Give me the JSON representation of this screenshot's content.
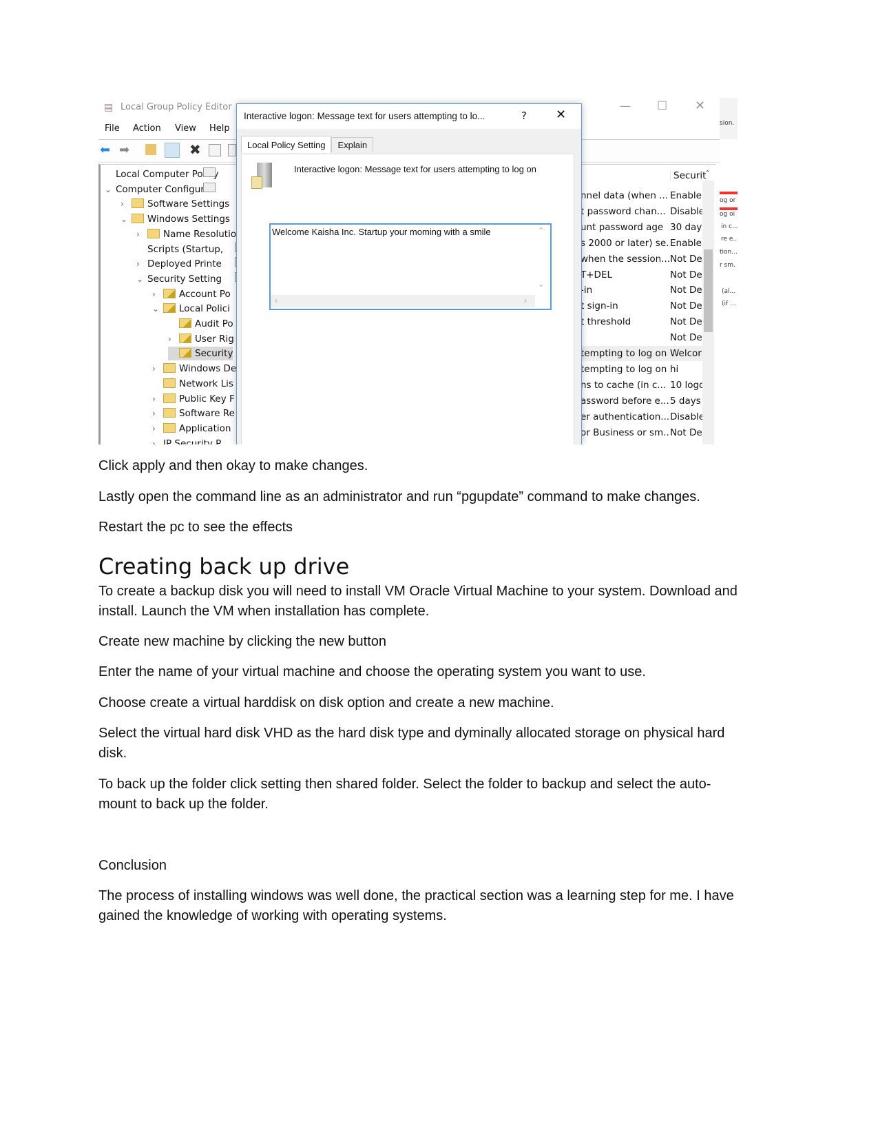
{
  "screenshot": {
    "main_window": {
      "title": "Local Group Policy Editor",
      "menu": [
        "File",
        "Action",
        "View",
        "Help"
      ],
      "window_controls": [
        "minimize-icon",
        "maximize-icon",
        "close-icon"
      ],
      "tree": [
        {
          "label": "Local Computer Policy",
          "level": 0,
          "chevron": "",
          "icon": "policy-icon"
        },
        {
          "label": "Computer Configurati",
          "level": 0,
          "chevron": "⌄",
          "icon": "computer-icon"
        },
        {
          "label": "Software Settings",
          "level": 1,
          "chevron": "›",
          "icon": "folder-icon"
        },
        {
          "label": "Windows Settings",
          "level": 1,
          "chevron": "⌄",
          "icon": "folder-icon"
        },
        {
          "label": "Name Resolutio",
          "level": 2,
          "chevron": "›",
          "icon": "folder-icon"
        },
        {
          "label": "Scripts (Startup,",
          "level": 2,
          "chevron": "",
          "icon": "script-icon"
        },
        {
          "label": "Deployed Printe",
          "level": 2,
          "chevron": "›",
          "icon": "printer-icon"
        },
        {
          "label": "Security Setting",
          "level": 2,
          "chevron": "⌄",
          "icon": "security-icon"
        },
        {
          "label": "Account Po",
          "level": 3,
          "chevron": "›",
          "icon": "lock-folder-icon"
        },
        {
          "label": "Local Polici",
          "level": 3,
          "chevron": "⌄",
          "icon": "lock-folder-icon"
        },
        {
          "label": "Audit Po",
          "level": 4,
          "chevron": "",
          "icon": "lock-folder-icon"
        },
        {
          "label": "User Rig",
          "level": 4,
          "chevron": "›",
          "icon": "lock-folder-icon"
        },
        {
          "label": "Security",
          "level": 4,
          "chevron": "",
          "icon": "lock-folder-icon",
          "selected": true
        },
        {
          "label": "Windows De",
          "level": 3,
          "chevron": "›",
          "icon": "folder-icon"
        },
        {
          "label": "Network Lis",
          "level": 3,
          "chevron": "",
          "icon": "folder-icon"
        },
        {
          "label": "Public Key F",
          "level": 3,
          "chevron": "›",
          "icon": "folder-icon"
        },
        {
          "label": "Software Re",
          "level": 3,
          "chevron": "›",
          "icon": "folder-icon"
        },
        {
          "label": "Application",
          "level": 3,
          "chevron": "›",
          "icon": "folder-icon"
        },
        {
          "label": "IP Security P",
          "level": 3,
          "chevron": "›",
          "icon": "network-icon"
        }
      ],
      "list_header": "Securit",
      "list_rows": [
        [
          "nnel data (when ...",
          "Enable"
        ],
        [
          "t password chan...",
          "Disable"
        ],
        [
          "unt password age",
          "30 days"
        ],
        [
          "s 2000 or later) se...",
          "Enable"
        ],
        [
          "when the session...",
          "Not De"
        ],
        [
          "T+DEL",
          "Not De"
        ],
        [
          "-in",
          "Not De"
        ],
        [
          "t sign-in",
          "Not De"
        ],
        [
          "t threshold",
          "Not De"
        ],
        [
          "",
          "Not De"
        ],
        [
          "tempting to log on",
          "Welcor"
        ],
        [
          "tempting to log on",
          "hi"
        ],
        [
          "ns to cache (in c...",
          "10 logo"
        ],
        [
          "assword before e...",
          "5 days"
        ],
        [
          "er authentication...",
          "Disable"
        ],
        [
          "or Business or sm...",
          "Not De"
        ]
      ],
      "background_window_fragments": [
        "sion.",
        "og or",
        "og oi",
        "in c...",
        "re e...",
        "tion...",
        "r sm.",
        "(al...",
        "(if ..."
      ]
    },
    "dialog": {
      "title": "Interactive logon: Message text for users attempting to lo...",
      "help_label": "?",
      "tabs": [
        "Local Policy Setting",
        "Explain"
      ],
      "heading": "Interactive logon: Message text for users attempting to log on",
      "message_value": "Welcome Kaisha Inc. Startup your moming with a smile"
    }
  },
  "document": {
    "paragraphs_before": [
      "Click apply and then okay to make changes.",
      "Lastly open the command line as an administrator and run “pgupdate” command to make changes.",
      "Restart the pc to see the effects"
    ],
    "heading": "Creating back up drive",
    "paragraphs_after": [
      "To create a backup disk you will need to install VM Oracle Virtual Machine to your system. Download and install. Launch the VM when installation has complete.",
      "Create new machine by clicking the new button",
      "Enter the name of your virtual machine and choose the operating system you want to use.",
      "Choose create a virtual harddisk on disk option and create a new machine.",
      "Select the virtual hard disk VHD as the hard disk type and dyminally allocated storage on physical hard disk.",
      "To back up the folder click setting then shared folder. Select the folder to backup and select the auto-mount to back up the folder."
    ],
    "conclusion_label": "Conclusion",
    "conclusion_text": "The process of installing windows was well done, the practical section was a learning step for me. I have gained the knowledge of working with operating systems."
  }
}
